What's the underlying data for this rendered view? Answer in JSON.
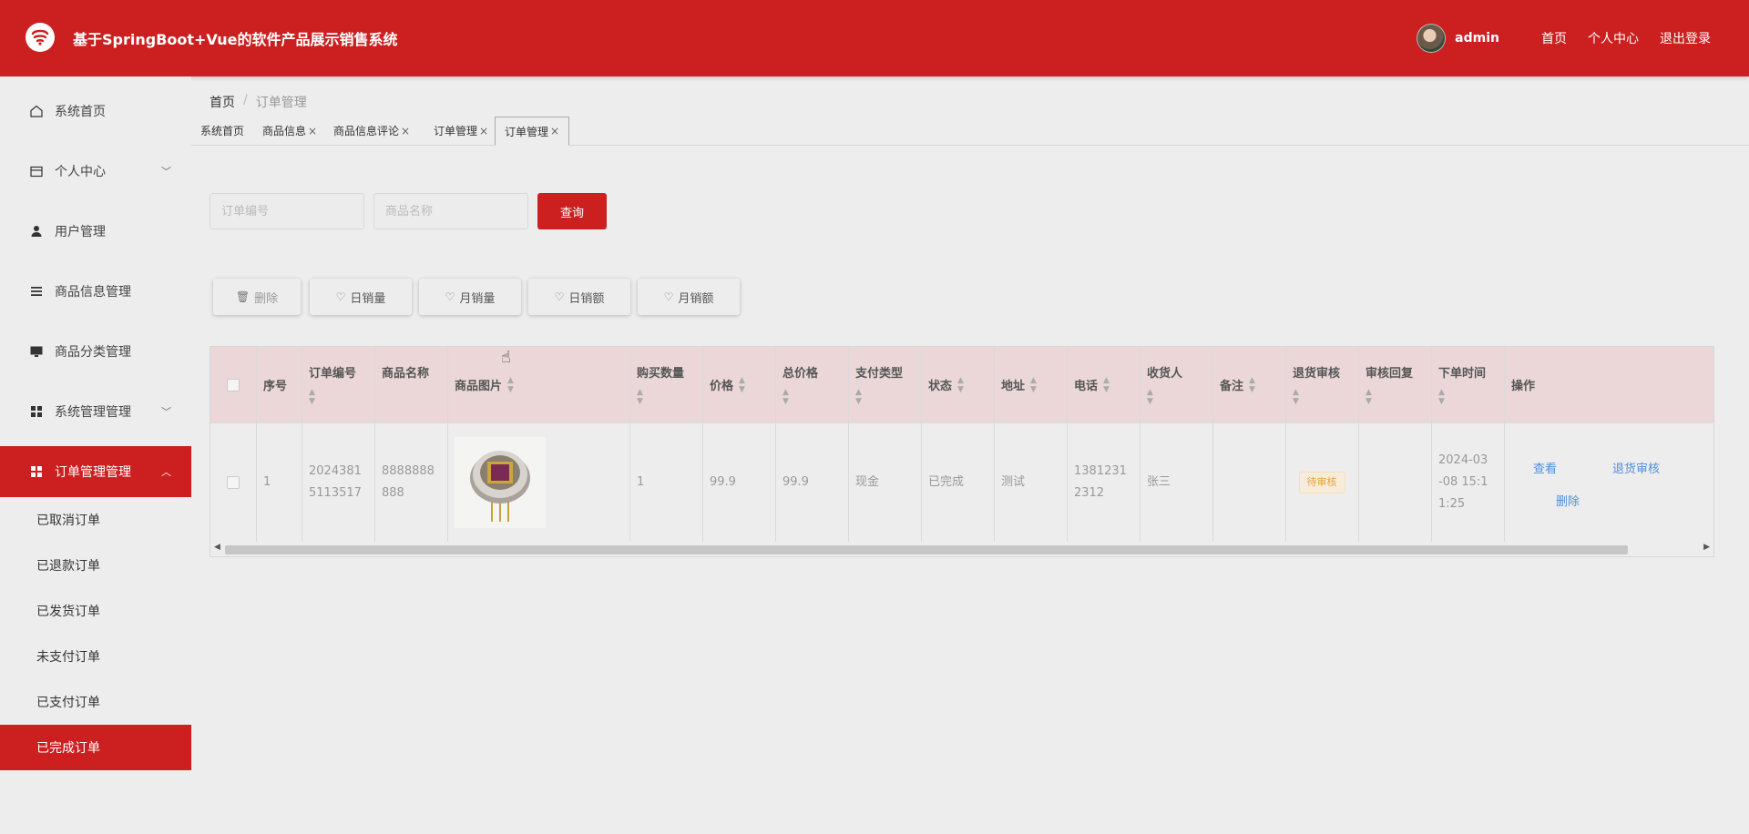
{
  "header": {
    "title": "基于SpringBoot+Vue的软件产品展示销售系统",
    "username": "admin",
    "links": [
      "首页",
      "个人中心",
      "退出登录"
    ]
  },
  "sidebar": {
    "items": [
      {
        "label": "系统首页",
        "icon": "home-icon"
      },
      {
        "label": "个人中心",
        "icon": "wallet-icon"
      },
      {
        "label": "用户管理",
        "icon": "user-icon"
      },
      {
        "label": "商品信息管理",
        "icon": "list-icon"
      },
      {
        "label": "商品分类管理",
        "icon": "monitor-icon"
      },
      {
        "label": "系统管理管理",
        "icon": "grid-icon"
      },
      {
        "label": "订单管理管理",
        "icon": "grid-icon"
      }
    ],
    "sub_items": [
      "已取消订单",
      "已退款订单",
      "已发货订单",
      "未支付订单",
      "已支付订单",
      "已完成订单"
    ]
  },
  "breadcrumb": {
    "home": "首页",
    "sep": "/",
    "current": "订单管理"
  },
  "tabs": [
    {
      "label": "系统首页",
      "closable": false
    },
    {
      "label": "商品信息",
      "closable": true
    },
    {
      "label": "商品信息评论",
      "closable": true
    },
    {
      "label": "订单管理",
      "closable": true
    },
    {
      "label": "订单管理",
      "closable": true
    }
  ],
  "search": {
    "order_no_placeholder": "订单编号",
    "product_name_placeholder": "商品名称",
    "query_label": "查询"
  },
  "actions": {
    "delete_label": "删除",
    "daily_sales_label": "日销量",
    "monthly_sales_label": "月销量",
    "daily_revenue_label": "日销额",
    "monthly_revenue_label": "月销额"
  },
  "table": {
    "headers": [
      "序号",
      "订单编号",
      "商品名称",
      "商品图片",
      "购买数量",
      "价格",
      "总价格",
      "支付类型",
      "状态",
      "地址",
      "电话",
      "收货人",
      "备注",
      "退货审核",
      "审核回复",
      "下单时间",
      "操作"
    ],
    "rows": [
      {
        "index": "1",
        "order_no_l1": "2024381",
        "order_no_l2": "5113517",
        "product_name_l1": "8888888",
        "product_name_l2": "888",
        "quantity": "1",
        "price": "99.9",
        "total": "99.9",
        "pay_type": "现金",
        "status": "已完成",
        "address": "测试",
        "phone_l1": "1381231",
        "phone_l2": "2312",
        "receiver": "张三",
        "note": "",
        "return_review": "待审核",
        "review_reply": "",
        "time_l1": "2024-03",
        "time_l2": "-08 15:1",
        "time_l3": "1:25",
        "op_view": "查看",
        "op_return": "退货审核",
        "op_delete": "删除"
      }
    ]
  },
  "colors": {
    "primary": "#cc2020",
    "header_row": "#ebd7d7",
    "link": "#4f8ee0",
    "pending": "#e6a23c"
  }
}
